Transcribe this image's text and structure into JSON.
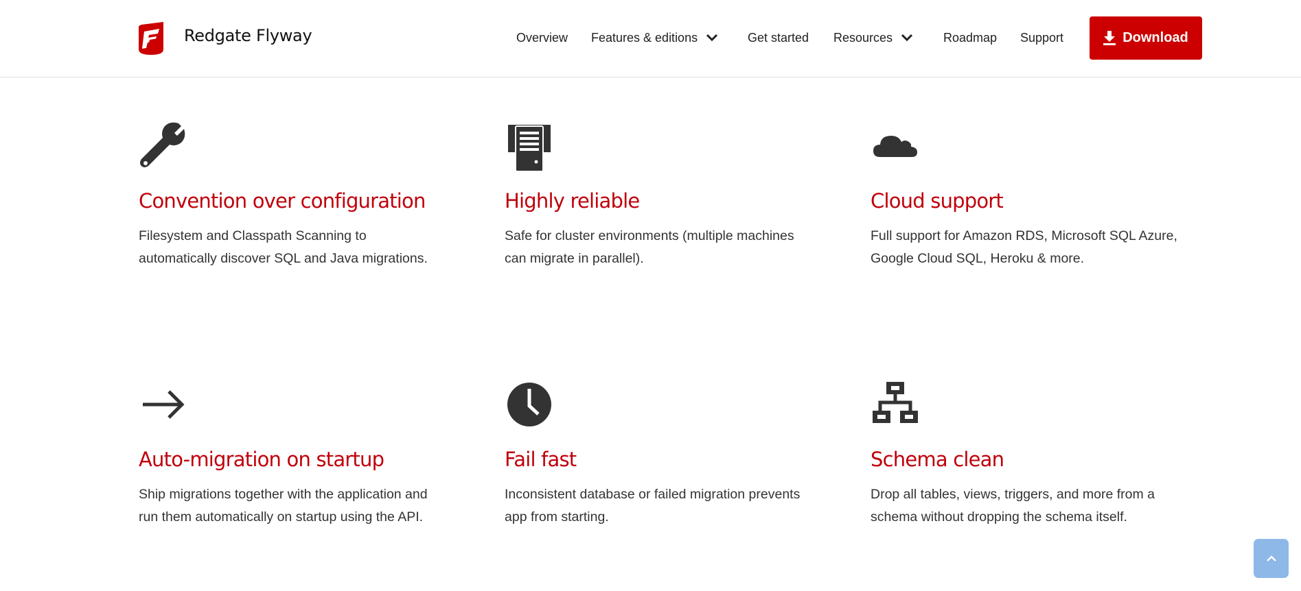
{
  "header": {
    "brand": "Redgate Flyway",
    "nav": [
      {
        "label": "Overview"
      },
      {
        "label": "Features & editions"
      },
      {
        "label": "Get started"
      },
      {
        "label": "Resources"
      },
      {
        "label": "Roadmap"
      },
      {
        "label": "Support"
      }
    ],
    "download_label": "Download"
  },
  "features": [
    {
      "icon": "wrench-icon",
      "title": "Convention over configuration",
      "desc": "Filesystem and Classpath Scanning to automatically discover SQL and Java migrations."
    },
    {
      "icon": "server-icon",
      "title": "Highly reliable",
      "desc": "Safe for cluster environments (multiple machines can migrate in parallel)."
    },
    {
      "icon": "cloud-icon",
      "title": "Cloud support",
      "desc": "Full support for Amazon RDS, Microsoft SQL Azure, Google Cloud SQL, Heroku & more."
    },
    {
      "icon": "arrow-right-icon",
      "title": "Auto-migration on startup",
      "desc": "Ship migrations together with the application and run them automatically on startup using the API."
    },
    {
      "icon": "clock-icon",
      "title": "Fail fast",
      "desc": "Inconsistent database or failed migration prevents app from starting."
    },
    {
      "icon": "sitemap-icon",
      "title": "Schema clean",
      "desc": "Drop all tables, views, triggers, and more from a schema without dropping the schema itself."
    }
  ],
  "colors": {
    "accent": "#cc0000",
    "heading": "#c0000b",
    "text": "#333333",
    "scroll_button": "#8db8e8"
  }
}
